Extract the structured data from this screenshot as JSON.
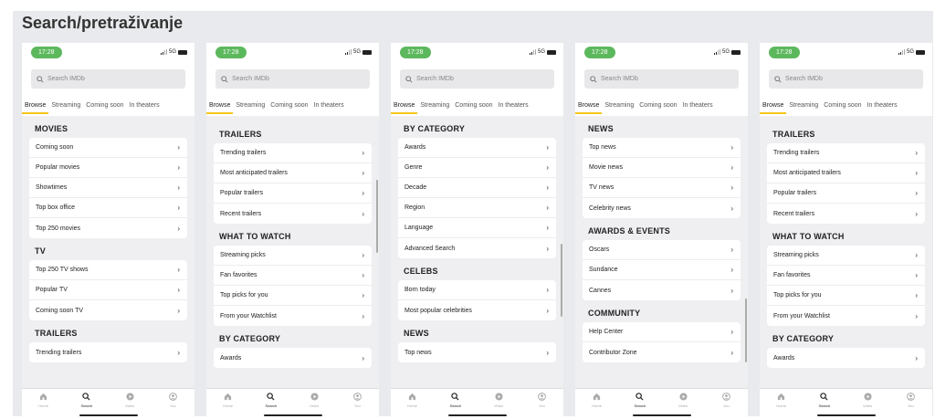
{
  "page_title": "Search/pretraživanje",
  "status": {
    "time": "17:28",
    "network": "5G"
  },
  "search_placeholder": "Search IMDb",
  "tabs": [
    "Browse",
    "Streaming",
    "Coming soon",
    "In theaters"
  ],
  "tab_bar": [
    "Home",
    "Search",
    "Video",
    "You"
  ],
  "screens": [
    {
      "sections": [
        {
          "title": "MOVIES",
          "items": [
            "Coming soon",
            "Popular movies",
            "Showtimes",
            "Top box office",
            "Top 250 movies"
          ]
        },
        {
          "title": "TV",
          "items": [
            "Top 250 TV shows",
            "Popular TV",
            "Coming soon TV"
          ]
        },
        {
          "title": "TRAILERS",
          "items": [
            "Trending trailers"
          ]
        }
      ]
    },
    {
      "sections": [
        {
          "title": "TRAILERS",
          "items": [
            "Trending trailers",
            "Most anticipated trailers",
            "Popular trailers",
            "Recent trailers"
          ]
        },
        {
          "title": "WHAT TO WATCH",
          "items": [
            "Streaming picks",
            "Fan favorites",
            "Top picks for you",
            "From your Watchlist"
          ]
        },
        {
          "title": "BY CATEGORY",
          "items": [
            "Awards"
          ]
        }
      ]
    },
    {
      "sections": [
        {
          "title": "BY CATEGORY",
          "items": [
            "Awards",
            "Genre",
            "Decade",
            "Region",
            "Language",
            "Advanced Search"
          ]
        },
        {
          "title": "CELEBS",
          "items": [
            "Born today",
            "Most popular celebrities"
          ]
        },
        {
          "title": "NEWS",
          "items": [
            "Top news"
          ]
        }
      ]
    },
    {
      "sections": [
        {
          "title": "NEWS",
          "items": [
            "Top news",
            "Movie news",
            "TV news",
            "Celebrity news"
          ]
        },
        {
          "title": "AWARDS & EVENTS",
          "items": [
            "Oscars",
            "Sundance",
            "Cannes"
          ]
        },
        {
          "title": "COMMUNITY",
          "items": [
            "Help Center",
            "Contributor Zone"
          ]
        }
      ]
    },
    {
      "sections": [
        {
          "title": "TRAILERS",
          "items": [
            "Trending trailers",
            "Most anticipated trailers",
            "Popular trailers",
            "Recent trailers"
          ]
        },
        {
          "title": "WHAT TO WATCH",
          "items": [
            "Streaming picks",
            "Fan favorites",
            "Top picks for you",
            "From your Watchlist"
          ]
        },
        {
          "title": "BY CATEGORY",
          "items": [
            "Awards"
          ]
        }
      ]
    }
  ]
}
